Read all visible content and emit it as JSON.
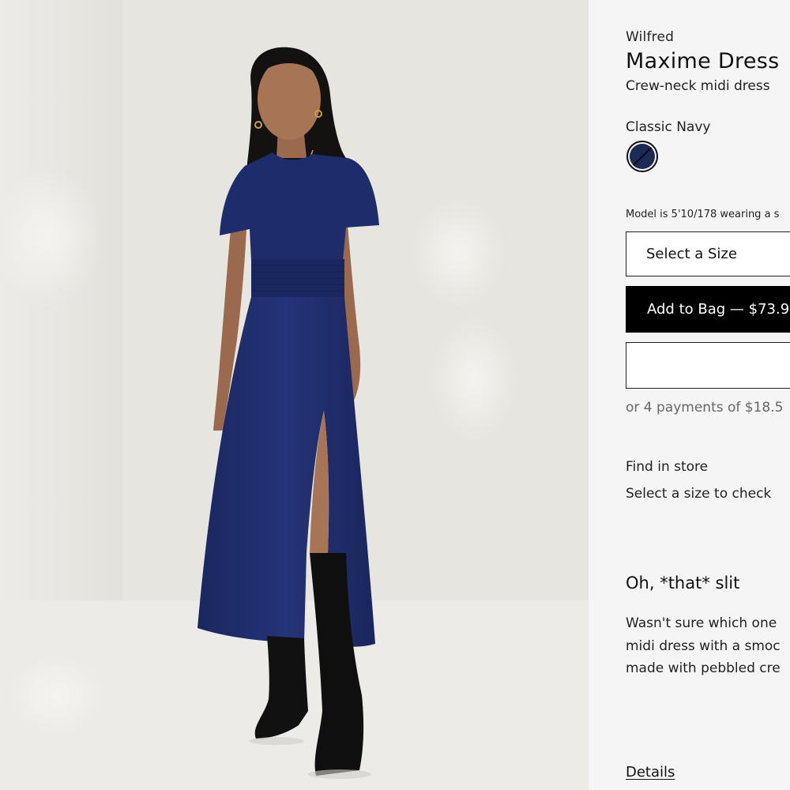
{
  "product": {
    "brand": "Wilfred",
    "name": "Maxime Dress",
    "subtitle": "Crew-neck midi dress",
    "color_name": "Classic Navy",
    "swatch_color": "#1d2a55",
    "model_note": "Model is 5'10/178 wearing a s",
    "size_select_label": "Select a Size",
    "add_to_bag_label": "Add to Bag — $73.9",
    "installments": "or 4 payments of $18.5",
    "find_in_store": "Find in store",
    "find_in_store_sub": "Select a size to check",
    "section_heading": "Oh, *that* slit",
    "description_lines": [
      "Wasn't sure which one",
      "midi dress with a smoc",
      "made with pebbled cre"
    ],
    "details_link": "Details"
  },
  "image": {
    "dress_color": "#1f2c6b",
    "background": "#e7e6e1"
  }
}
